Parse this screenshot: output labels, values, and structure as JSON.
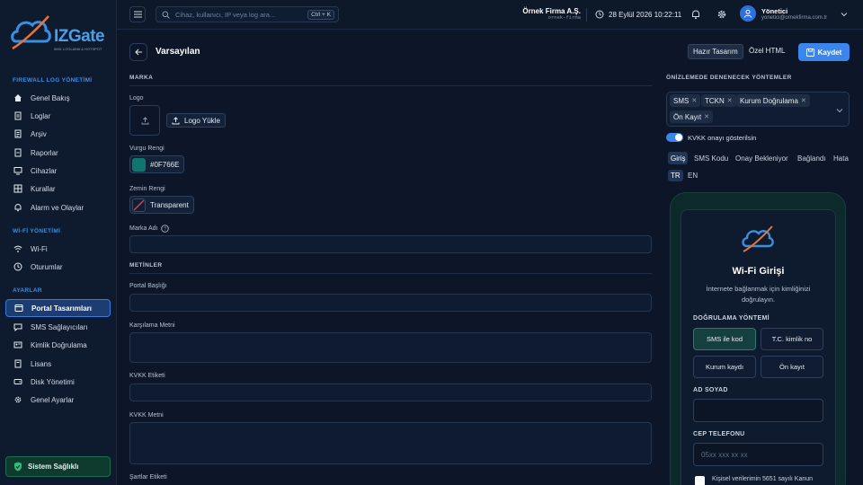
{
  "brand": {
    "name": "IZGate",
    "tagline": "5651 LOGLAMA & HOTSPOT"
  },
  "sidebar": {
    "sections": [
      {
        "title": "FIREWALL LOG YÖNETİMİ",
        "items": [
          "Genel Bakış",
          "Loglar",
          "Arşiv",
          "Raporlar",
          "Cihazlar",
          "Kurallar",
          "Alarm ve Olaylar"
        ]
      },
      {
        "title": "Wİ-Fİ YÖNETİMİ",
        "items": [
          "Wi-Fi",
          "Oturumlar"
        ]
      },
      {
        "title": "AYARLAR",
        "items": [
          "Portal Tasarımları",
          "SMS Sağlayıcıları",
          "Kimlik Doğrulama",
          "Lisans",
          "Disk Yönetimi",
          "Genel Ayarlar"
        ]
      }
    ],
    "active_item": "Portal Tasarımları",
    "health": "Sistem Sağlıklı"
  },
  "topbar": {
    "search_placeholder": "Cihaz, kullanıcı, IP veya log ara...",
    "shortcut": "Ctrl + K",
    "company": "Örnek Firma A.Ş.",
    "company_slug": "ornek-firma",
    "datetime": "28 Eylül 2026 10:22:11",
    "user_name": "Yönetici",
    "user_email": "yonetici@ornekfirma.com.tr"
  },
  "page": {
    "title": "Varsayılan",
    "preset_button": "Hazır Tasarım",
    "html_button": "Özel HTML",
    "save_button": "Kaydet"
  },
  "form": {
    "brand_section": "MARKA",
    "logo_label": "Logo",
    "logo_upload": "Logo Yükle",
    "accent_label": "Vurgu Rengi",
    "accent_value": "#0F766E",
    "bg_label": "Zemin Rengi",
    "bg_value": "Transparent",
    "brand_name_label": "Marka Adı",
    "texts_section": "METİNLER",
    "portal_title_label": "Portal Başlığı",
    "welcome_label": "Karşılama Metni",
    "kvkk_tag_label": "KVKK Etiketi",
    "kvkk_text_label": "KVKK Metni",
    "terms_label": "Şartlar Etiketi"
  },
  "preview": {
    "methods_title": "ÖNİZLEMEDE DENENECEK YÖNTEMLER",
    "chips": [
      "SMS",
      "TCKN",
      "Kurum Doğrulama",
      "Ön Kayıt"
    ],
    "toggle_label": "KVKK onayı gösterilsin",
    "tabs": [
      "Giriş",
      "SMS Kodu",
      "Onay Bekleniyor",
      "Bağlandı",
      "Hata"
    ],
    "langs": [
      "TR",
      "EN"
    ],
    "card_title": "Wi-Fi Girişi",
    "card_sub": "İnternete bağlanmak için kimliğinizi doğrulayın.",
    "auth_label": "DOĞRULAMA YÖNTEMİ",
    "methods": [
      "SMS ile kod",
      "T.C. kimlik no",
      "Kurum kaydı",
      "Ön kayıt"
    ],
    "name_label": "AD SOYAD",
    "phone_label": "CEP TELEFONU",
    "phone_placeholder": "05xx xxx xx xx",
    "consent": "Kişisel verilerimin 5651 sayılı Kanun"
  },
  "colors": {
    "accent": "#0F766E",
    "primary": "#3A86EC",
    "bg": "#0C1628"
  }
}
